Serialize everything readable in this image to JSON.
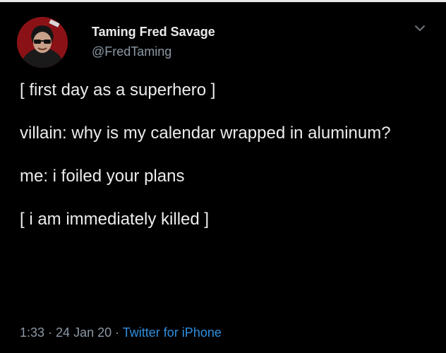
{
  "author": {
    "display_name": "Taming Fred Savage",
    "handle": "@FredTaming"
  },
  "tweet": {
    "line1": "[ first day as a superhero ]",
    "line2": "villain: why is my calendar wrapped in aluminum?",
    "line3": "me: i foiled your plans",
    "line4": "[ i am immediately killed ]"
  },
  "meta": {
    "time": "1:33",
    "sep1": " · ",
    "date": "24 Jan 20",
    "sep2": " · ",
    "source": "Twitter for iPhone"
  },
  "colors": {
    "background": "#000000",
    "text": "#ececec",
    "muted": "#8b98a5",
    "link": "#2f8fe0",
    "avatar_bg": "#8a1216"
  },
  "icons": {
    "more": "chevron-down-icon"
  }
}
